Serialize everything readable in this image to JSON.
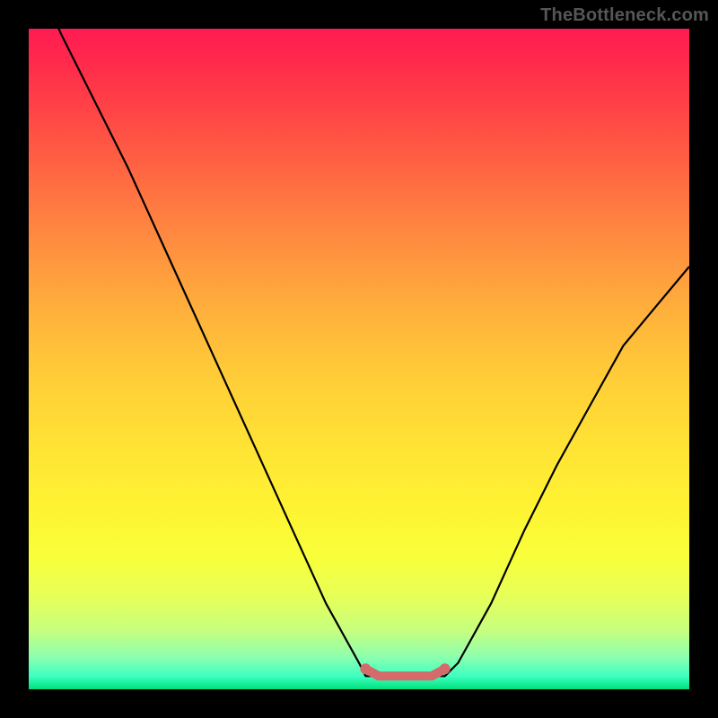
{
  "watermark": "TheBottleneck.com",
  "chart_data": {
    "type": "line",
    "title": "",
    "xlabel": "",
    "ylabel": "",
    "xlim": [
      0,
      100
    ],
    "ylim": [
      0,
      100
    ],
    "series": [
      {
        "name": "bottleneck-curve",
        "x": [
          0,
          5,
          10,
          15,
          20,
          25,
          30,
          35,
          40,
          45,
          50,
          51,
          55,
          60,
          63,
          65,
          70,
          75,
          80,
          85,
          90,
          95,
          100
        ],
        "values": [
          110,
          99,
          89,
          79,
          68,
          57,
          46,
          35,
          24,
          13,
          4,
          2,
          2,
          2,
          2,
          4,
          13,
          24,
          34,
          43,
          52,
          58,
          64
        ]
      },
      {
        "name": "optimal-highlight",
        "x": [
          51,
          53,
          55,
          57,
          59,
          61,
          63
        ],
        "values": [
          2,
          2,
          2,
          2,
          2,
          2,
          2
        ]
      }
    ],
    "gradient": {
      "description": "Vertical gradient indicating bottleneck severity: red (high) at top through orange/yellow to green (low) at bottom.",
      "stops": [
        {
          "pos": 0,
          "color": "#ff1b52"
        },
        {
          "pos": 50,
          "color": "#ffd037"
        },
        {
          "pos": 85,
          "color": "#e6ff58"
        },
        {
          "pos": 100,
          "color": "#00e27b"
        }
      ]
    },
    "highlight_color": "#d46a6a"
  }
}
